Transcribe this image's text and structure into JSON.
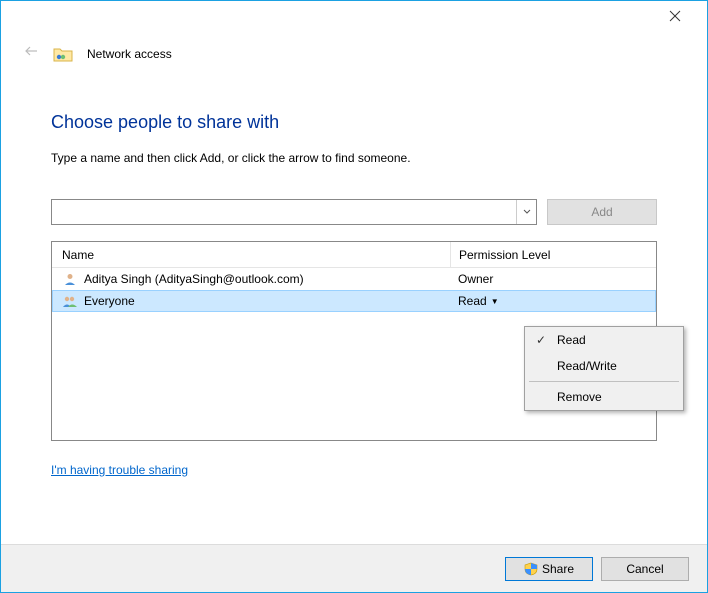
{
  "window": {
    "back_tooltip": "Back",
    "close_tooltip": "Close",
    "header_title": "Network access"
  },
  "content": {
    "heading": "Choose people to share with",
    "instruction": "Type a name and then click Add, or click the arrow to find someone.",
    "name_input_value": "",
    "add_button": "Add",
    "columns": {
      "name": "Name",
      "perm": "Permission Level"
    },
    "rows": [
      {
        "name": "Aditya Singh (AdityaSingh@outlook.com)",
        "perm": "Owner",
        "selected": false,
        "icon": "user"
      },
      {
        "name": "Everyone",
        "perm": "Read",
        "selected": true,
        "icon": "group"
      }
    ],
    "trouble_link": "I'm having trouble sharing"
  },
  "context_menu": {
    "items": [
      {
        "label": "Read",
        "checked": true
      },
      {
        "label": "Read/Write",
        "checked": false
      }
    ],
    "remove": "Remove"
  },
  "footer": {
    "share": "Share",
    "cancel": "Cancel"
  }
}
